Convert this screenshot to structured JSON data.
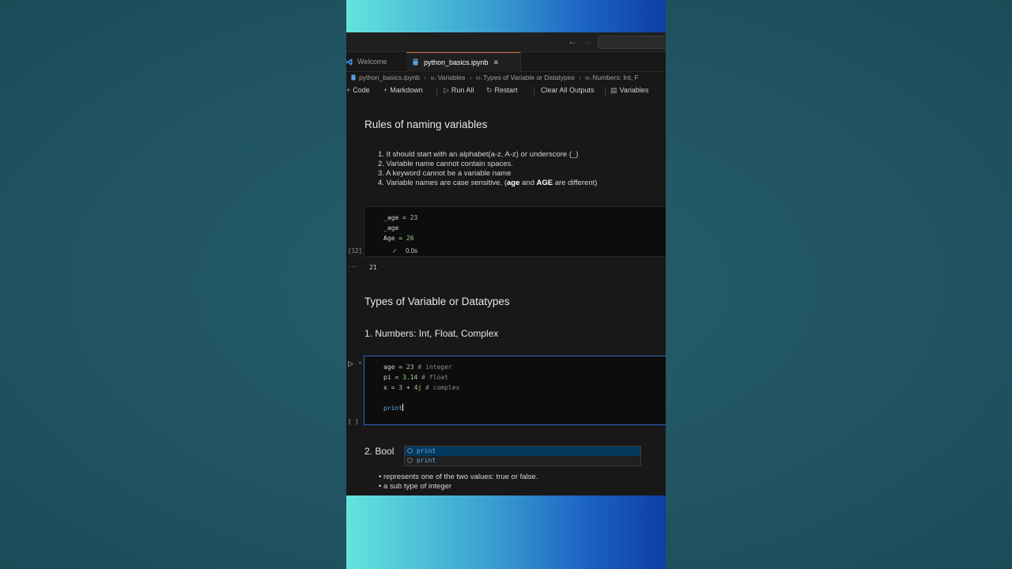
{
  "nav": {
    "back": "←",
    "forward": "→"
  },
  "tabs": [
    {
      "label": "Welcome"
    },
    {
      "label": "python_basics.ipynb",
      "close": "✕"
    }
  ],
  "breadcrumb": [
    {
      "label": "python_basics.ipynb"
    },
    {
      "prefix": "M↓",
      "label": "Variables"
    },
    {
      "prefix": "M↓",
      "label": "Types of Variable or Datatypes"
    },
    {
      "prefix": "M↓",
      "label": "Numbers: Int, F"
    }
  ],
  "toolbar": {
    "code": "Code",
    "markdown": "Markdown",
    "run_all": "Run All",
    "restart": "Restart",
    "clear_outputs": "Clear All Outputs",
    "variables": "Variables"
  },
  "cells": {
    "rules_heading": "Rules of naming variables",
    "rules": [
      "1. It should start with an alphabet(a-z, A-z) or underscore (_)",
      "2. Variable name cannot contain spaces.",
      "3. A keyword cannot be a variable name"
    ],
    "rule4": {
      "prefix": "4. Variable names are case sensitive. (",
      "b1": "age",
      "mid": " and ",
      "b2": "AGE",
      "suffix": " are different)"
    },
    "cell12": {
      "line1": {
        "name": "_age",
        "eq": " = ",
        "val": "23"
      },
      "line2": "_age",
      "line3": {
        "name": "Age",
        "eq": " = ",
        "val": "26"
      },
      "exec_count": "[12]",
      "check": "✓",
      "time": "0.0s",
      "output_dots": "···",
      "output": "21"
    },
    "types_heading": "Types of Variable or Datatypes",
    "numbers_heading": "1. Numbers: Int, Float, Complex",
    "code2": {
      "line1": {
        "name": "age",
        "eq": " = ",
        "val": "23",
        "comment": " # integer"
      },
      "line2": {
        "name": "pi",
        "eq": " = ",
        "val": "3.14",
        "comment": " # float"
      },
      "line3": {
        "name": "x",
        "eq": " = ",
        "v1": "3",
        "plus": " + ",
        "v2": "4j",
        "comment": " # complex"
      },
      "line4": "print",
      "exec_count": "[ ]",
      "run": "▷",
      "chevron": "⌄"
    },
    "suggestions": [
      "print",
      "print"
    ],
    "bool_heading": "2. Bool",
    "bool_items": [
      "represents one of the two values: true or false.",
      "a sub type of integer"
    ]
  },
  "colors": {
    "accent_focus": "#3067c0",
    "tab_indicator": "#ce6b45",
    "keyword": "#5fb0f0",
    "number": "#9fcf8c"
  }
}
